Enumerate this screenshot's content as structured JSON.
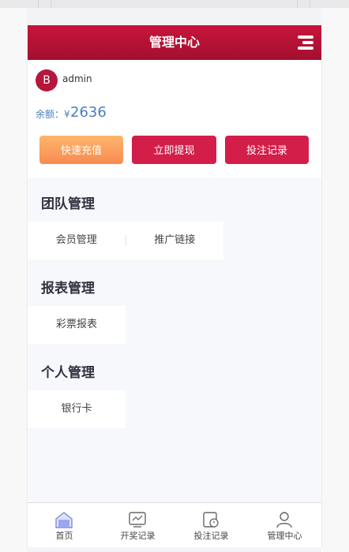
{
  "header": {
    "title": "管理中心",
    "menu_icon": "hamburger-menu-icon"
  },
  "user": {
    "avatar_letter": "B",
    "username": "admin"
  },
  "balance": {
    "label": "余额：¥",
    "value": "2636"
  },
  "actions": [
    {
      "label": "快速充值"
    },
    {
      "label": "立即提现"
    },
    {
      "label": "投注记录"
    }
  ],
  "sections": [
    {
      "title": "团队管理",
      "items": [
        "会员管理",
        "推广链接"
      ]
    },
    {
      "title": "报表管理",
      "items": [
        "彩票报表"
      ]
    },
    {
      "title": "个人管理",
      "items": [
        "银行卡"
      ]
    }
  ],
  "tabbar": [
    {
      "label": "首页",
      "icon": "home-icon"
    },
    {
      "label": "开奖记录",
      "icon": "draw-results-icon"
    },
    {
      "label": "投注记录",
      "icon": "bet-records-icon"
    },
    {
      "label": "管理中心",
      "icon": "user-center-icon"
    }
  ],
  "colors": {
    "primary": "#c8153a",
    "accent_orange": "#f78a52",
    "balance_blue": "#4a7fc1"
  }
}
